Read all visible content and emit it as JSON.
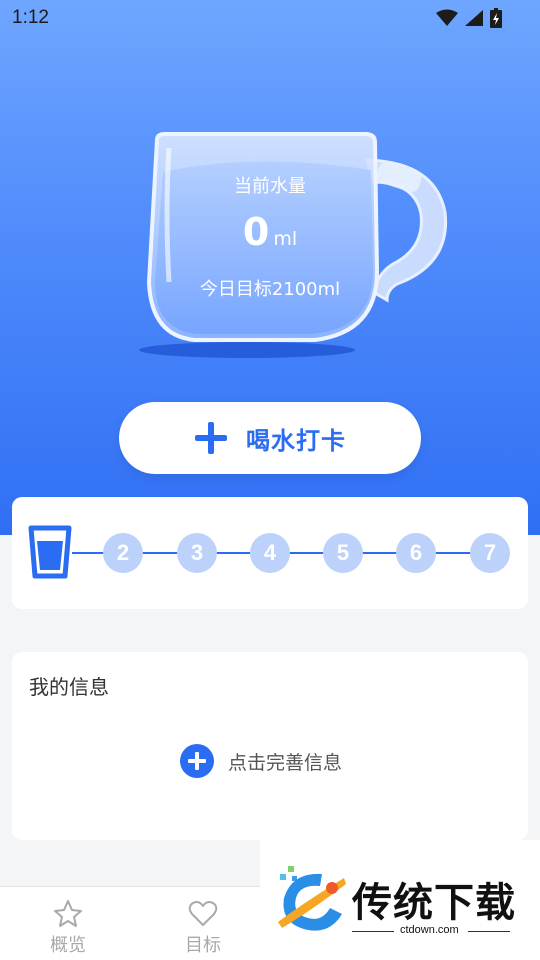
{
  "status_bar": {
    "time": "1:12"
  },
  "hero": {
    "current_label": "当前水量",
    "current_value": "0",
    "current_unit": "ml",
    "daily_goal": "今日目标2100ml",
    "checkin_label": "喝水打卡"
  },
  "progress": {
    "current_step": 1,
    "steps": [
      "2",
      "3",
      "4",
      "5",
      "6",
      "7"
    ]
  },
  "info": {
    "title": "我的信息",
    "action_label": "点击完善信息"
  },
  "bottom_nav": {
    "items": [
      {
        "label": "概览",
        "icon": "star-icon"
      },
      {
        "label": "目标",
        "icon": "heart-icon"
      }
    ]
  },
  "watermark": {
    "title": "传统下载",
    "url": "ctdown.com"
  },
  "colors": {
    "accent": "#2a6cf2",
    "hero_top": "#6ea6ff",
    "hero_bottom": "#2f6ff4",
    "step_inactive": "#bcd2fb"
  }
}
